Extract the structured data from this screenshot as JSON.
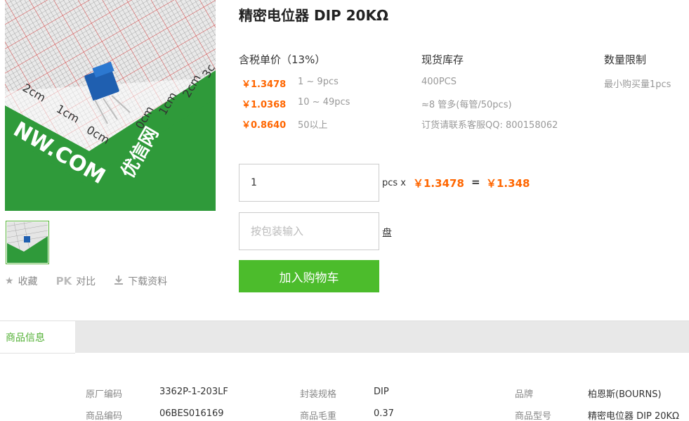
{
  "product": {
    "title": "精密电位器 DIP 20KΩ",
    "image_logo_text": "优信网",
    "image_site_text": "NW.COM",
    "image_ruler_labels": [
      "3c",
      "2cm",
      "1cm",
      "0cm",
      "2cm",
      "1cm",
      "0cm",
      "cm"
    ]
  },
  "actions": {
    "favorite": "收藏",
    "compare_badge": "PK",
    "compare": "对比",
    "download": "下载资料"
  },
  "pricing": {
    "header": "含税单价（13%）",
    "tiers": [
      {
        "price": "￥1.3478",
        "range": "1 ~ 9pcs"
      },
      {
        "price": "￥1.0368",
        "range": "10 ~ 49pcs"
      },
      {
        "price": "￥0.8640",
        "range": "50以上"
      }
    ]
  },
  "stock": {
    "header": "现货库存",
    "lines": [
      "400PCS",
      "≈8 管多(每管/50pcs)",
      "订货请联系客服QQ: 800158062"
    ]
  },
  "limit": {
    "header": "数量限制",
    "text": "最小购买量1pcs"
  },
  "order": {
    "quantity_value": "1",
    "unit_pcs": "pcs x",
    "unit_price": "￥1.3478",
    "equals": "=",
    "total": "￥1.348",
    "package_placeholder": "按包装输入",
    "package_unit": "盘",
    "add_to_cart": "加入购物车"
  },
  "tabs": {
    "active": "商品信息"
  },
  "specs": [
    {
      "label": "原厂编码",
      "value": "3362P-1-203LF"
    },
    {
      "label": "封装规格",
      "value": "DIP"
    },
    {
      "label": "品牌",
      "value": "柏恩斯(BOURNS)"
    },
    {
      "label": "商品编码",
      "value": "06BES016169"
    },
    {
      "label": "商品毛重",
      "value": "0.37"
    },
    {
      "label": "商品型号",
      "value": "精密电位器 DIP 20KΩ"
    }
  ],
  "colors": {
    "accent_green": "#4cbc2c",
    "price_orange": "#ff6600",
    "mat_green": "#2f9a3a"
  }
}
